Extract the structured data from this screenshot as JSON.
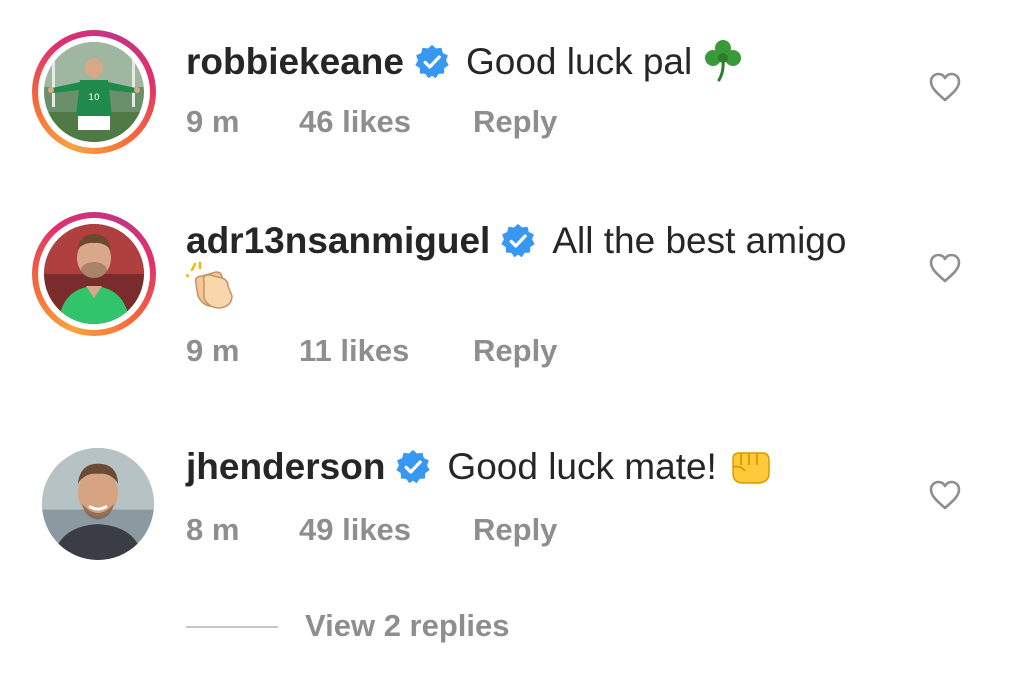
{
  "comments": [
    {
      "username": "robbiekeane",
      "verified": true,
      "text": "Good luck pal",
      "emoji": "shamrock-emoji",
      "time": "9 m",
      "likes": "46 likes",
      "reply": "Reply",
      "story_ring": true
    },
    {
      "username": "adr13nsanmiguel",
      "verified": true,
      "text": "All the best amigo",
      "emoji": "clapping-hands-emoji",
      "time": "9 m",
      "likes": "11 likes",
      "reply": "Reply",
      "story_ring": true
    },
    {
      "username": "jhenderson",
      "verified": true,
      "text": "Good luck mate!",
      "emoji": "fist-emoji",
      "time": "8 m",
      "likes": "49 likes",
      "reply": "Reply",
      "story_ring": false
    }
  ],
  "view_replies": "View 2 replies",
  "colors": {
    "text": "#262626",
    "meta": "#8e8e8e",
    "verified": "#3897f0",
    "heart_outline": "#8e8e8e"
  }
}
